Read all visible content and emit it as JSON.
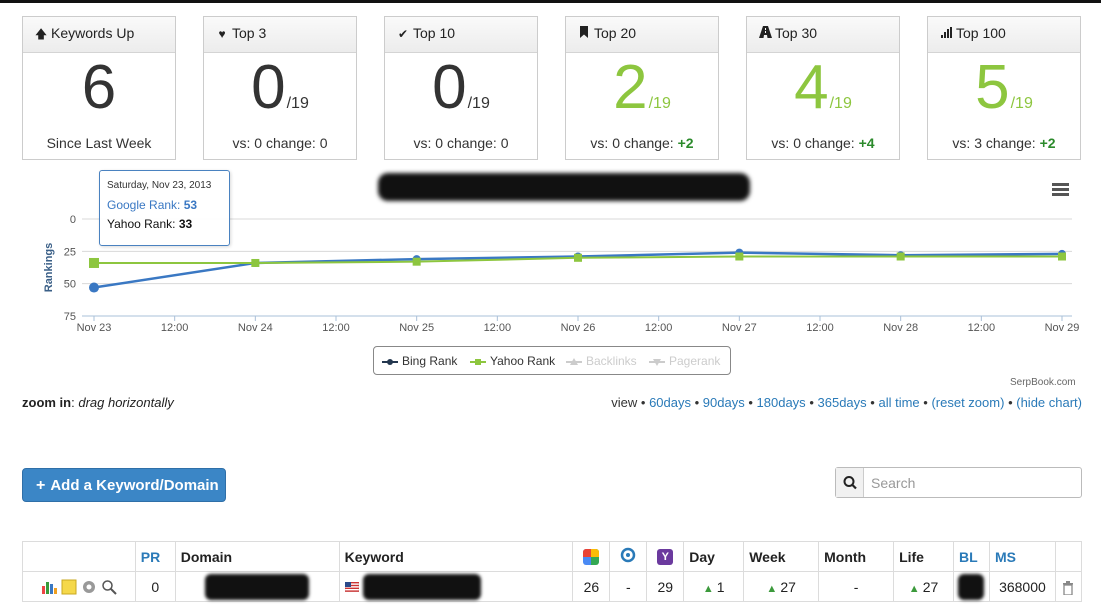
{
  "cards": [
    {
      "icon": "arrow-up-icon",
      "title": "Keywords Up",
      "value": "6",
      "denominator": "",
      "footer_prefix": "Since Last Week",
      "change": "",
      "green": false
    },
    {
      "icon": "heart-icon",
      "title": "Top 3",
      "value": "0",
      "denominator": "/19",
      "footer_prefix": "vs: 0 change:",
      "change": "0",
      "green": false
    },
    {
      "icon": "check-icon",
      "title": "Top 10",
      "value": "0",
      "denominator": "/19",
      "footer_prefix": "vs: 0 change:",
      "change": "0",
      "green": false
    },
    {
      "icon": "bookmark-icon",
      "title": "Top 20",
      "value": "2",
      "denominator": "/19",
      "footer_prefix": "vs: 0 change:",
      "change": "+2",
      "green": true
    },
    {
      "icon": "road-icon",
      "title": "Top 30",
      "value": "4",
      "denominator": "/19",
      "footer_prefix": "vs: 0 change:",
      "change": "+4",
      "green": true
    },
    {
      "icon": "signal-bars-icon",
      "title": "Top 100",
      "value": "5",
      "denominator": "/19",
      "footer_prefix": "vs: 3 change:",
      "change": "+2",
      "green": true
    }
  ],
  "tooltip": {
    "date": "Saturday, Nov 23, 2013",
    "google_label": "Google Rank:",
    "google_value": "53",
    "yahoo_label": "Yahoo Rank:",
    "yahoo_value": "33"
  },
  "chart_data": {
    "type": "line",
    "ylabel": "Rankings",
    "y_ticks": [
      "0",
      "25",
      "50",
      "75"
    ],
    "ylim": [
      0,
      75
    ],
    "y_reversed": true,
    "x_tick_labels": [
      "Nov 23",
      "12:00",
      "Nov 24",
      "12:00",
      "Nov 25",
      "12:00",
      "Nov 26",
      "12:00",
      "Nov 27",
      "12:00",
      "Nov 28",
      "12:00",
      "Nov 29"
    ],
    "x": [
      "Nov 23",
      "Nov 24",
      "Nov 25",
      "Nov 26",
      "Nov 27",
      "Nov 28",
      "Nov 29"
    ],
    "grid": true,
    "series": [
      {
        "name": "Bing Rank",
        "color": "#3a78c3",
        "marker": "circle",
        "visible": true,
        "values": [
          53,
          34,
          31,
          29,
          26,
          28,
          27
        ]
      },
      {
        "name": "Yahoo Rank",
        "color": "#8dc63f",
        "marker": "square",
        "visible": true,
        "values": [
          34,
          34,
          33,
          30,
          29,
          29,
          29
        ]
      },
      {
        "name": "Backlinks",
        "color": "#cccccc",
        "marker": "triangle",
        "visible": false,
        "values": []
      },
      {
        "name": "Pagerank",
        "color": "#cccccc",
        "marker": "triangle-down",
        "visible": false,
        "values": []
      }
    ],
    "legend_position": "bottom"
  },
  "credit": "SerpBook.com",
  "zoom": {
    "label": "zoom in",
    "hint": "drag horizontally"
  },
  "view": {
    "prefix": "view",
    "links": [
      "60days",
      "90days",
      "180days",
      "365days",
      "all time",
      "(reset zoom)",
      "(hide chart)"
    ]
  },
  "add_button": "Add a Keyword/Domain",
  "search": {
    "placeholder": "Search"
  },
  "table": {
    "headers": {
      "pr": "PR",
      "domain": "Domain",
      "keyword": "Keyword",
      "day": "Day",
      "week": "Week",
      "month": "Month",
      "life": "Life",
      "bl": "BL",
      "ms": "MS"
    },
    "row": {
      "pr": "0",
      "google": "26",
      "bing": "-",
      "yahoo": "29",
      "day": "1",
      "week": "27",
      "month": "-",
      "life": "27",
      "ms": "368000"
    }
  },
  "colors": {
    "accent": "#3b86c6",
    "green": "#8dc63f",
    "link": "#2a7ab8"
  }
}
